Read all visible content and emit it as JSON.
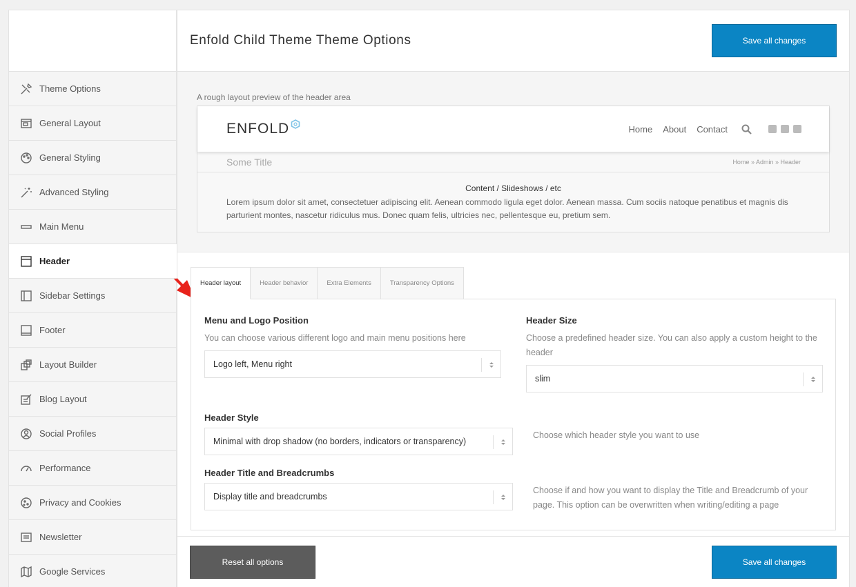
{
  "page": {
    "title": "Enfold Child Theme Theme Options"
  },
  "actions": {
    "save_label": "Save all changes",
    "reset_label": "Reset all options"
  },
  "sidebar": {
    "items": [
      {
        "label": "Theme Options",
        "icon": "tools-icon"
      },
      {
        "label": "General Layout",
        "icon": "layout-icon"
      },
      {
        "label": "General Styling",
        "icon": "palette-icon"
      },
      {
        "label": "Advanced Styling",
        "icon": "magic-wand-icon"
      },
      {
        "label": "Main Menu",
        "icon": "menu-bar-icon"
      },
      {
        "label": "Header",
        "icon": "header-icon",
        "active": true
      },
      {
        "label": "Sidebar Settings",
        "icon": "sidebar-icon"
      },
      {
        "label": "Footer",
        "icon": "footer-icon"
      },
      {
        "label": "Layout Builder",
        "icon": "builder-icon"
      },
      {
        "label": "Blog Layout",
        "icon": "blog-icon"
      },
      {
        "label": "Social Profiles",
        "icon": "social-icon"
      },
      {
        "label": "Performance",
        "icon": "gauge-icon"
      },
      {
        "label": "Privacy and Cookies",
        "icon": "cookie-icon"
      },
      {
        "label": "Newsletter",
        "icon": "newsletter-icon"
      },
      {
        "label": "Google Services",
        "icon": "map-icon"
      }
    ]
  },
  "preview": {
    "caption": "A rough layout preview of the header area",
    "logo": "ENFOLD",
    "nav": [
      "Home",
      "About",
      "Contact"
    ],
    "page_title": "Some Title",
    "breadcrumbs": "Home » Admin » Header",
    "content_title": "Content / Slideshows / etc",
    "content_text": "Lorem ipsum dolor sit amet, consectetuer adipiscing elit. Aenean commodo ligula eget dolor. Aenean massa. Cum sociis natoque penatibus et magnis dis parturient montes, nascetur ridiculus mus. Donec quam felis, ultricies nec, pellentesque eu, pretium sem."
  },
  "tabs": [
    {
      "label": "Header layout",
      "active": true
    },
    {
      "label": "Header behavior"
    },
    {
      "label": "Extra Elements"
    },
    {
      "label": "Transparency Options"
    }
  ],
  "options": {
    "menu_logo": {
      "label": "Menu and Logo Position",
      "desc": "You can choose various different logo and main menu positions here",
      "value": "Logo left, Menu right"
    },
    "header_size": {
      "label": "Header Size",
      "desc": "Choose a predefined header size. You can also apply a custom height to the header",
      "value": "slim"
    },
    "header_style": {
      "label": "Header Style",
      "desc": "Choose which header style you want to use",
      "value": "Minimal with drop shadow (no borders, indicators or transparency)"
    },
    "title_breadcrumbs": {
      "label": "Header Title and Breadcrumbs",
      "desc": "Choose if and how you want to display the Title and Breadcrumb of your page. This option can be overwritten when writing/editing a page",
      "value": "Display title and breadcrumbs"
    }
  },
  "colors": {
    "primary": "#0b85c4",
    "reset": "#5c5c5c",
    "annotation": "#e8221b"
  }
}
